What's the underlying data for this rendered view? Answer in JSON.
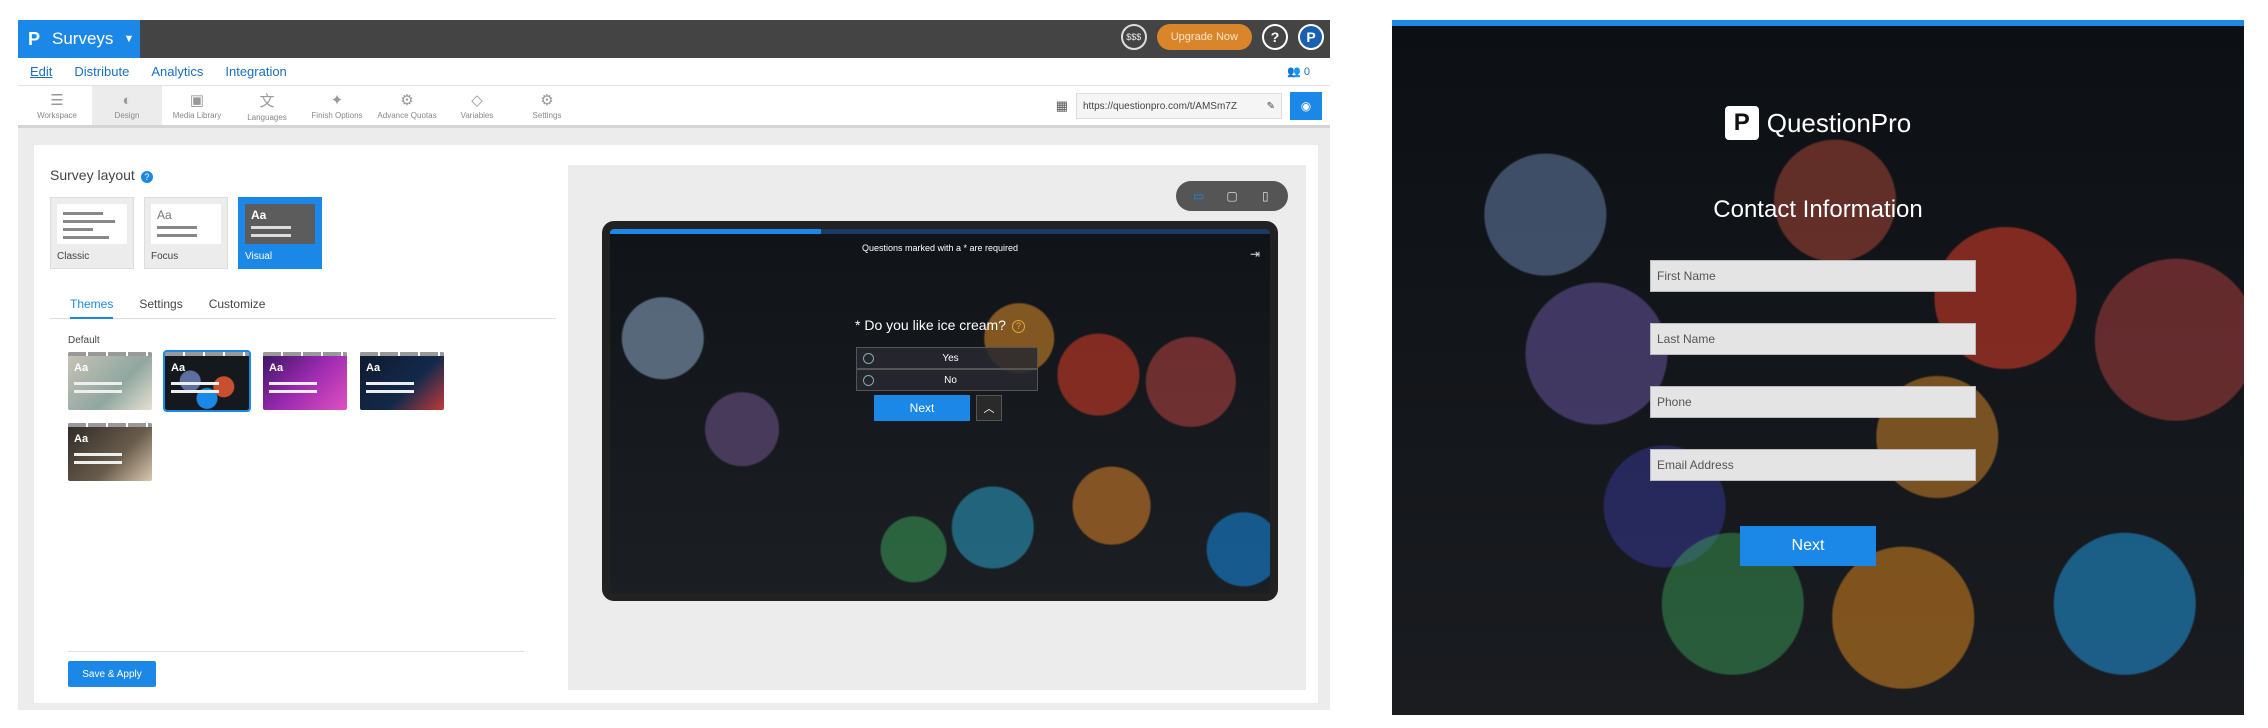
{
  "app": {
    "brand": "Surveys",
    "brand_logo": "P",
    "top": {
      "coins": "$$$",
      "upgrade": "Upgrade Now",
      "help": "?",
      "profile": "P"
    },
    "nav": [
      {
        "label": "Edit"
      },
      {
        "label": "Distribute"
      },
      {
        "label": "Analytics"
      },
      {
        "label": "Integration"
      }
    ],
    "users_count": "0",
    "tools": [
      {
        "label": "Workspace",
        "icon": "workspace-icon"
      },
      {
        "label": "Design",
        "icon": "palette-icon"
      },
      {
        "label": "Media Library",
        "icon": "image-icon"
      },
      {
        "label": "Languages",
        "icon": "language-icon"
      },
      {
        "label": "Finish Options",
        "icon": "magic-wand-icon"
      },
      {
        "label": "Advance Quotas",
        "icon": "quota-icon"
      },
      {
        "label": "Variables",
        "icon": "tag-icon"
      },
      {
        "label": "Settings",
        "icon": "gear-icon"
      }
    ],
    "url": "https://questionpro.com/t/AMSm7Z"
  },
  "design": {
    "heading": "Survey layout",
    "layouts": [
      {
        "label": "Classic"
      },
      {
        "label": "Focus"
      },
      {
        "label": "Visual"
      }
    ],
    "tabs": [
      {
        "label": "Themes"
      },
      {
        "label": "Settings"
      },
      {
        "label": "Customize"
      }
    ],
    "default_label": "Default",
    "theme_aa": "Aa",
    "save_label": "Save & Apply"
  },
  "preview": {
    "required_note": "Questions marked with a * are required",
    "question": "* Do you like ice cream?",
    "options": [
      {
        "label": "Yes"
      },
      {
        "label": "No"
      }
    ],
    "next": "Next"
  },
  "contact": {
    "logo_text": "QuestionPro",
    "logo_glyph": "P",
    "title": "Contact Information",
    "fields": [
      {
        "placeholder": "First Name"
      },
      {
        "placeholder": "Last Name"
      },
      {
        "placeholder": "Phone"
      },
      {
        "placeholder": "Email Address"
      }
    ],
    "next": "Next"
  },
  "colors": {
    "accent": "#1b87e6",
    "upgrade": "#d9862b",
    "topbar": "#444444"
  }
}
